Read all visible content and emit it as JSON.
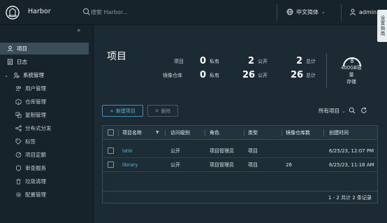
{
  "header": {
    "app_title": "Harbor",
    "search_placeholder": "搜索 Harbor...",
    "language": "中文简体",
    "user": "admin",
    "side_tab": "设置指南"
  },
  "sidebar": {
    "items": [
      {
        "label": "项目",
        "icon": "user-icon",
        "active": true
      },
      {
        "label": "日志",
        "icon": "log-icon"
      },
      {
        "label": "系统管理",
        "icon": "admin-icon",
        "expanded": true
      },
      {
        "label": "用户管理",
        "icon": "users-icon"
      },
      {
        "label": "仓库管理",
        "icon": "registry-icon"
      },
      {
        "label": "复制管理",
        "icon": "replication-icon"
      },
      {
        "label": "分布式分发",
        "icon": "distribution-icon"
      },
      {
        "label": "标签",
        "icon": "tag-icon"
      },
      {
        "label": "项目定额",
        "icon": "quota-icon"
      },
      {
        "label": "审查服务",
        "icon": "shield-icon"
      },
      {
        "label": "垃圾清理",
        "icon": "trash-icon"
      },
      {
        "label": "配置管理",
        "icon": "gear-icon"
      }
    ]
  },
  "main": {
    "title": "项目",
    "stats": {
      "projects_label": "项目",
      "repos_label": "镜像仓库",
      "private_unit": "私有",
      "public_unit": "公开",
      "total_unit": "总计",
      "projects_private": "0",
      "projects_public": "2",
      "projects_total": "2",
      "repos_private": "0",
      "repos_public": "26",
      "repos_total": "26"
    },
    "quota": {
      "value": "8",
      "line1": "400GB容",
      "line2": "量",
      "line3": "存储"
    },
    "toolbar": {
      "new_project": "新建项目",
      "delete": "删除",
      "filter": "所有项目"
    },
    "table": {
      "columns": [
        "项目名称",
        "访问级别",
        "角色",
        "类型",
        "镜像仓库数",
        "创建时间"
      ],
      "rows": [
        {
          "name": "istio",
          "access": "公开",
          "role": "项目管理员",
          "type": "项目",
          "repos": "",
          "created": "6/25/23, 12:07 PM"
        },
        {
          "name": "library",
          "access": "公开",
          "role": "项目管理员",
          "type": "项目",
          "repos": "26",
          "created": "6/25/23, 11:18 AM"
        }
      ],
      "footer": "1 - 2 共计 2 条记录"
    }
  },
  "colors": {
    "background": "#1b2a33",
    "accent": "#5db1e4",
    "active_nav": "#3a4d59"
  }
}
